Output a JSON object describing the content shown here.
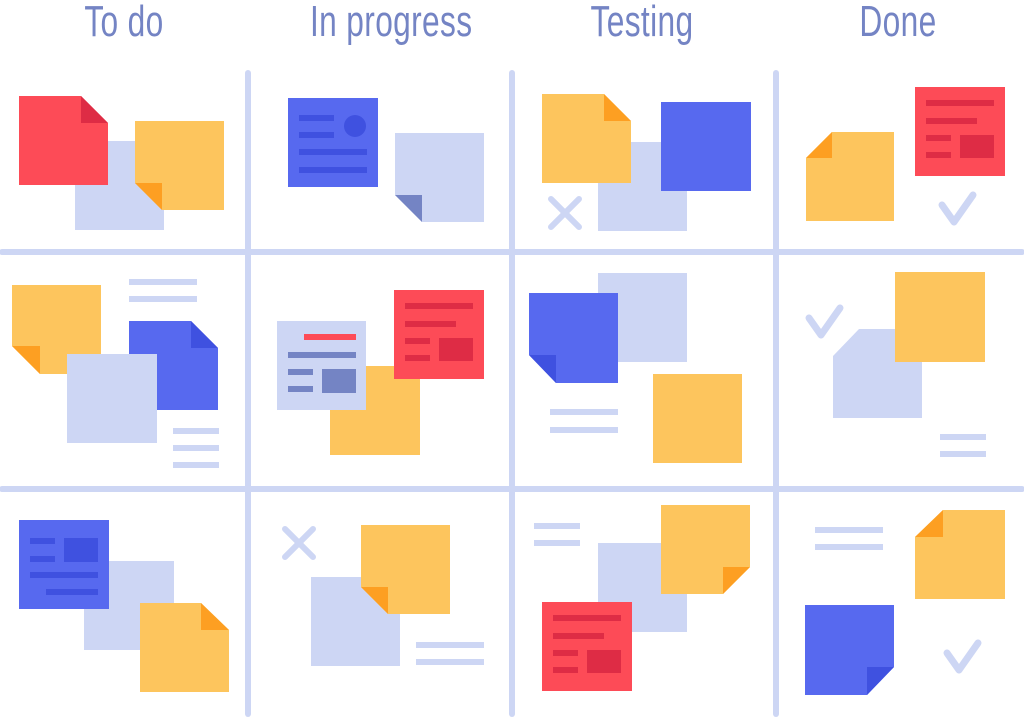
{
  "board": {
    "columns": [
      {
        "title": "To do"
      },
      {
        "title": "In progress"
      },
      {
        "title": "Testing"
      },
      {
        "title": "Done"
      }
    ],
    "rows": 3,
    "colors": {
      "grid": "#cdd6f4",
      "title": "#7484c4",
      "red": "#fd4b57",
      "red_dark": "#de2c45",
      "yellow": "#fdc55d",
      "yellow_fold": "#fd9f22",
      "blue": "#5769ef",
      "blue_dark": "#3f51e0",
      "lavender": "#cdd6f4",
      "slate": "#7484c4"
    },
    "cells": [
      {
        "column": "To do",
        "row": 1,
        "notes": [
          "red folded note",
          "lavender note",
          "yellow folded note"
        ]
      },
      {
        "column": "In progress",
        "row": 1,
        "notes": [
          "blue card with avatar",
          "lavender folded note"
        ]
      },
      {
        "column": "Testing",
        "row": 1,
        "notes": [
          "yellow folded note",
          "lavender note",
          "blue note"
        ],
        "marks": [
          "cross"
        ]
      },
      {
        "column": "Done",
        "row": 1,
        "notes": [
          "yellow folded note",
          "red text card"
        ],
        "marks": [
          "check"
        ]
      },
      {
        "column": "To do",
        "row": 2,
        "notes": [
          "yellow folded note",
          "blue folded note",
          "lavender note"
        ],
        "marks": [
          "lines",
          "lines"
        ]
      },
      {
        "column": "In progress",
        "row": 2,
        "notes": [
          "lavender text card",
          "yellow note",
          "red text card"
        ]
      },
      {
        "column": "Testing",
        "row": 2,
        "notes": [
          "lavender note",
          "blue folded note",
          "yellow note"
        ],
        "marks": [
          "lines"
        ]
      },
      {
        "column": "Done",
        "row": 2,
        "notes": [
          "lavender cut note",
          "yellow note"
        ],
        "marks": [
          "check",
          "lines"
        ]
      },
      {
        "column": "To do",
        "row": 3,
        "notes": [
          "blue text card",
          "lavender note",
          "yellow folded note"
        ]
      },
      {
        "column": "In progress",
        "row": 3,
        "notes": [
          "lavender note",
          "yellow folded note"
        ],
        "marks": [
          "cross",
          "lines"
        ]
      },
      {
        "column": "Testing",
        "row": 3,
        "notes": [
          "lavender note",
          "yellow folded note",
          "red text card"
        ],
        "marks": [
          "lines"
        ]
      },
      {
        "column": "Done",
        "row": 3,
        "notes": [
          "yellow folded note",
          "blue folded note"
        ],
        "marks": [
          "lines",
          "check"
        ]
      }
    ]
  }
}
